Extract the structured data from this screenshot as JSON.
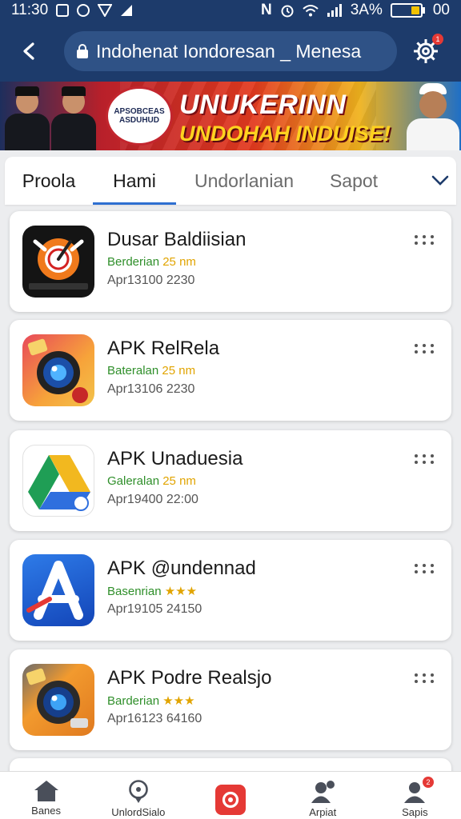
{
  "status_bar": {
    "time": "11:30",
    "battery": "3A%",
    "battery_level": 0.3,
    "right_time": "00",
    "icons": [
      "image-icon",
      "location-icon",
      "vpn-icon",
      "signal-icon",
      "nfc-icon",
      "alarm-icon",
      "wifi-icon",
      "cell-signal-icon",
      "battery-icon"
    ]
  },
  "app_bar": {
    "url": "Indohenat Iondoresan _ Menesa",
    "notification_count": "1"
  },
  "banner": {
    "headline": "UNUKERINN",
    "subline": "UNDOHAH INDUISE!",
    "seal_line1": "APSOBCEAS",
    "seal_line2": "ASDUHUD"
  },
  "tabs": [
    "Proola",
    "Hami",
    "Undorlanian",
    "Sapot"
  ],
  "active_tab": "Hami",
  "apps": [
    {
      "title": "Dusar Baldiisian",
      "sub_label": "Berderian",
      "sub_value": "25 nm",
      "meta": "Apr13100  2230",
      "icon": "alarm-clock-icon"
    },
    {
      "title": "APK RelRela",
      "sub_label": "Bateralan",
      "sub_value": "25 nm",
      "meta": "Apr13106  2230",
      "icon": "camera-icon"
    },
    {
      "title": "APK Unaduesia",
      "sub_label": "Galeralan",
      "sub_value": "25 nm",
      "meta": "Apr19400  22:00",
      "icon": "drive-icon"
    },
    {
      "title": "APK @undennad",
      "sub_label": "Basenrian",
      "sub_value": "★★★",
      "meta": "Apr19105  24150",
      "icon": "app-store-icon"
    },
    {
      "title": "APK Podre Realsjo",
      "sub_label": "Barderian",
      "sub_value": "★★★",
      "meta": "Apr16123  64160",
      "icon": "camera-icon"
    }
  ],
  "bottom_nav": [
    {
      "label": "Banes",
      "icon": "home-icon"
    },
    {
      "label": "UnlordSialo",
      "icon": "location-pin-icon"
    },
    {
      "label": "",
      "icon": "record-icon"
    },
    {
      "label": "Arpiat",
      "icon": "profile-lock-icon"
    },
    {
      "label": "Sapis",
      "icon": "user-icon",
      "badge": "2"
    }
  ],
  "colors": {
    "header": "#1d3b6b",
    "accent": "#2e6fd1",
    "subtitle_green": "#2f8f2a",
    "highlight_yellow": "#e1a400",
    "nav_center_red": "#e53935"
  }
}
